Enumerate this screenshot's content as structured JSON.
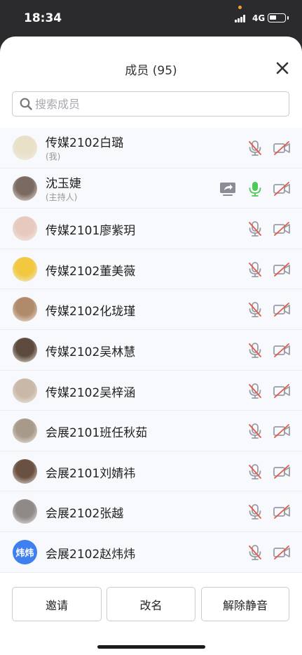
{
  "status_bar": {
    "time": "18:34",
    "network": "4G"
  },
  "header": {
    "title": "成员 (95)",
    "close_icon": "close-icon"
  },
  "search": {
    "placeholder": "搜索成员",
    "value": ""
  },
  "members": [
    {
      "name": "传媒2102白璐",
      "role": "(我)",
      "mic": "muted",
      "camera": "off",
      "avatar_color": "#e9e0c8"
    },
    {
      "name": "沈玉婕",
      "role": "(主持人)",
      "mic": "active",
      "camera": "off",
      "sharing": true,
      "avatar_color": "#7b6a62"
    },
    {
      "name": "传媒2101廖紫玥",
      "mic": "muted",
      "camera": "off",
      "avatar_color": "#e7c9c0"
    },
    {
      "name": "传媒2102董美薇",
      "mic": "muted",
      "camera": "off",
      "avatar_color": "#f1c840"
    },
    {
      "name": "传媒2102化珑瑾",
      "mic": "muted",
      "camera": "off",
      "avatar_color": "#b08a6a"
    },
    {
      "name": "传媒2102吴林慧",
      "mic": "muted",
      "camera": "off",
      "avatar_color": "#5d4a3e"
    },
    {
      "name": "传媒2102吴梓涵",
      "mic": "muted",
      "camera": "off",
      "avatar_color": "#c9b7a8"
    },
    {
      "name": "会展2101班任秋茹",
      "mic": "muted",
      "camera": "off",
      "avatar_color": "#a89a8a"
    },
    {
      "name": "会展2101刘婧祎",
      "mic": "muted",
      "camera": "off",
      "avatar_color": "#6a5040"
    },
    {
      "name": "会展2102张越",
      "mic": "muted",
      "camera": "off",
      "avatar_color": "#8f8a88"
    },
    {
      "name": "会展2102赵炜炜",
      "mic": "muted",
      "camera": "off",
      "avatar_text": "炜炜",
      "avatar_color": "#3f7ff0"
    }
  ],
  "footer": {
    "invite": "邀请",
    "rename": "改名",
    "unmute_all": "解除静音"
  },
  "colors": {
    "accent": "#3f7ff0",
    "mic_active": "#4fc95a",
    "mute_slash": "#e05a4a",
    "icon_gray": "#9a9da6"
  }
}
